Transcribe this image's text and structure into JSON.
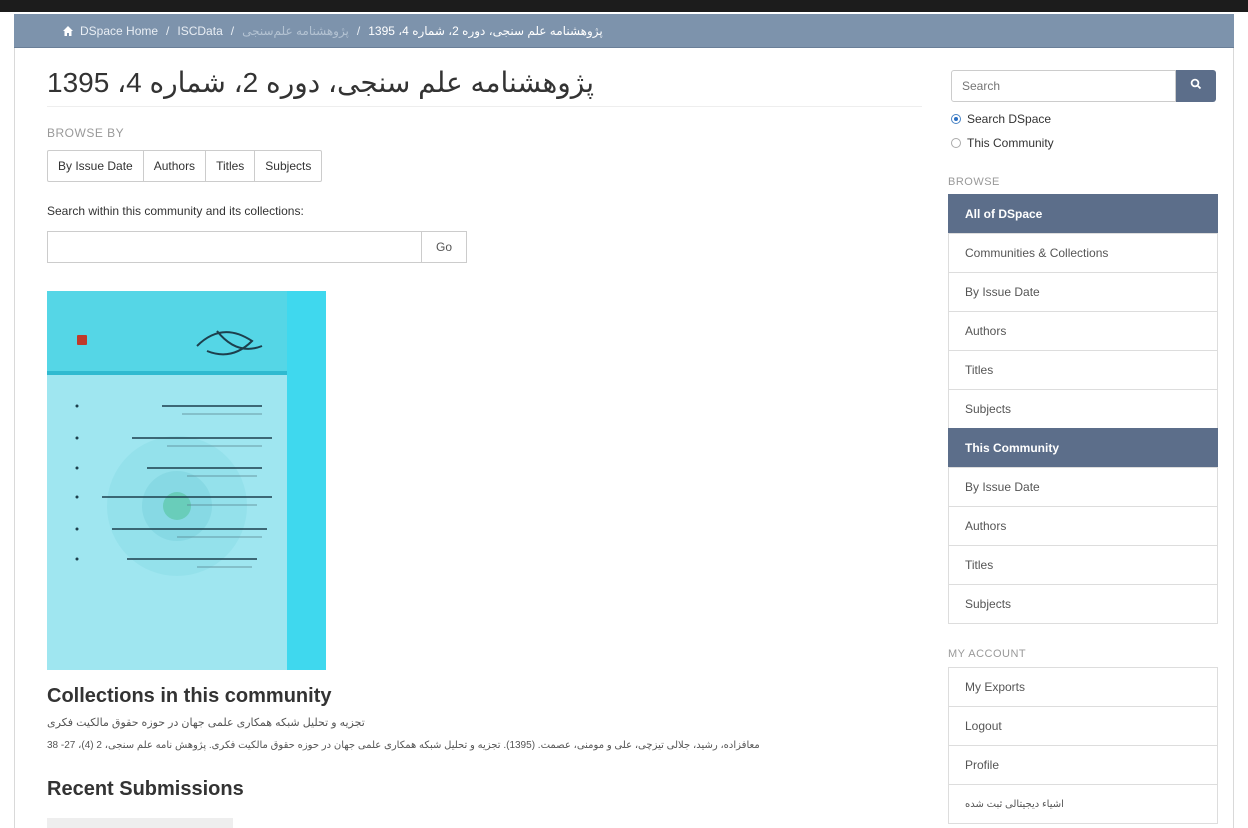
{
  "breadcrumb": {
    "home": "DSpace Home",
    "sep": "/",
    "item2": "ISCData",
    "item3": "پژوهشنامه علم‌سنجی",
    "current": "پژوهشنامه علم سنجی، دوره 2، شماره 4، 1395"
  },
  "page": {
    "title": "پژوهشنامه علم سنجی، دوره 2، شماره 4، 1395"
  },
  "browse_by": {
    "heading": "BROWSE BY",
    "buttons": [
      "By Issue Date",
      "Authors",
      "Titles",
      "Subjects"
    ]
  },
  "community_search": {
    "label": "Search within this community and its collections:",
    "placeholder": "",
    "go_label": "Go"
  },
  "collections": {
    "heading": "Collections in this community",
    "link_text": "تجزیه و تحلیل شبکه همکاری علمی جهان در حوزه حقوق مالکیت فکری",
    "citation": "معافزاده، رشید، جلالی تیزچی، علی و مومنی، عصمت. (1395). تجزیه و تحلیل شبکه همکاری علمی جهان در حوزه حقوق مالکیت فکری. پژوهش نامه علم سنجی، 2 (4)، 27- 38"
  },
  "recent": {
    "heading": "Recent Submissions"
  },
  "sidebar": {
    "search_placeholder": "Search",
    "scope": {
      "option1": "Search DSpace",
      "option2": "This Community"
    },
    "browse_heading": "BROWSE",
    "browse_all_header": "All of DSpace",
    "browse_all_items": [
      "Communities & Collections",
      "By Issue Date",
      "Authors",
      "Titles",
      "Subjects"
    ],
    "browse_community_header": "This Community",
    "browse_community_items": [
      "By Issue Date",
      "Authors",
      "Titles",
      "Subjects"
    ],
    "account_heading": "MY ACCOUNT",
    "account_items": [
      "My Exports",
      "Logout",
      "Profile",
      "اشیاء دیجیتالی ثبت شده"
    ]
  },
  "colors": {
    "accent": "#5c6e8a",
    "breadcrumb_bg": "#7d93ac",
    "logo_cyan": "#3fd8ee",
    "logo_light": "#9fe6f0"
  },
  "icons": {
    "home": "home-icon",
    "search": "search-icon"
  }
}
